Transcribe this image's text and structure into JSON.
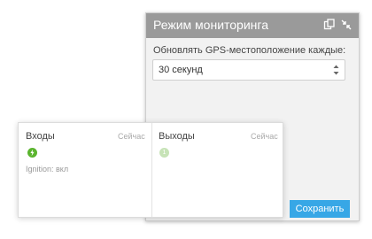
{
  "dialog": {
    "title": "Режим мониторинга",
    "icons": [
      "copy-icon",
      "collapse-icon"
    ],
    "gps_label": "Обновлять GPS-местоположение каждые:",
    "interval_value": "30  секунд",
    "save_label": "Сохранить"
  },
  "card": {
    "inputs": {
      "title": "Входы",
      "time": "Сейчас",
      "badge_icon": "lightning-icon",
      "ignition": "Ignition: вкл"
    },
    "outputs": {
      "title": "Выходы",
      "time": "Сейчас",
      "badge_text": "1"
    }
  },
  "colors": {
    "header": "#9a9a9a",
    "accent": "#37a7e6",
    "status_green": "#5ab42e"
  }
}
